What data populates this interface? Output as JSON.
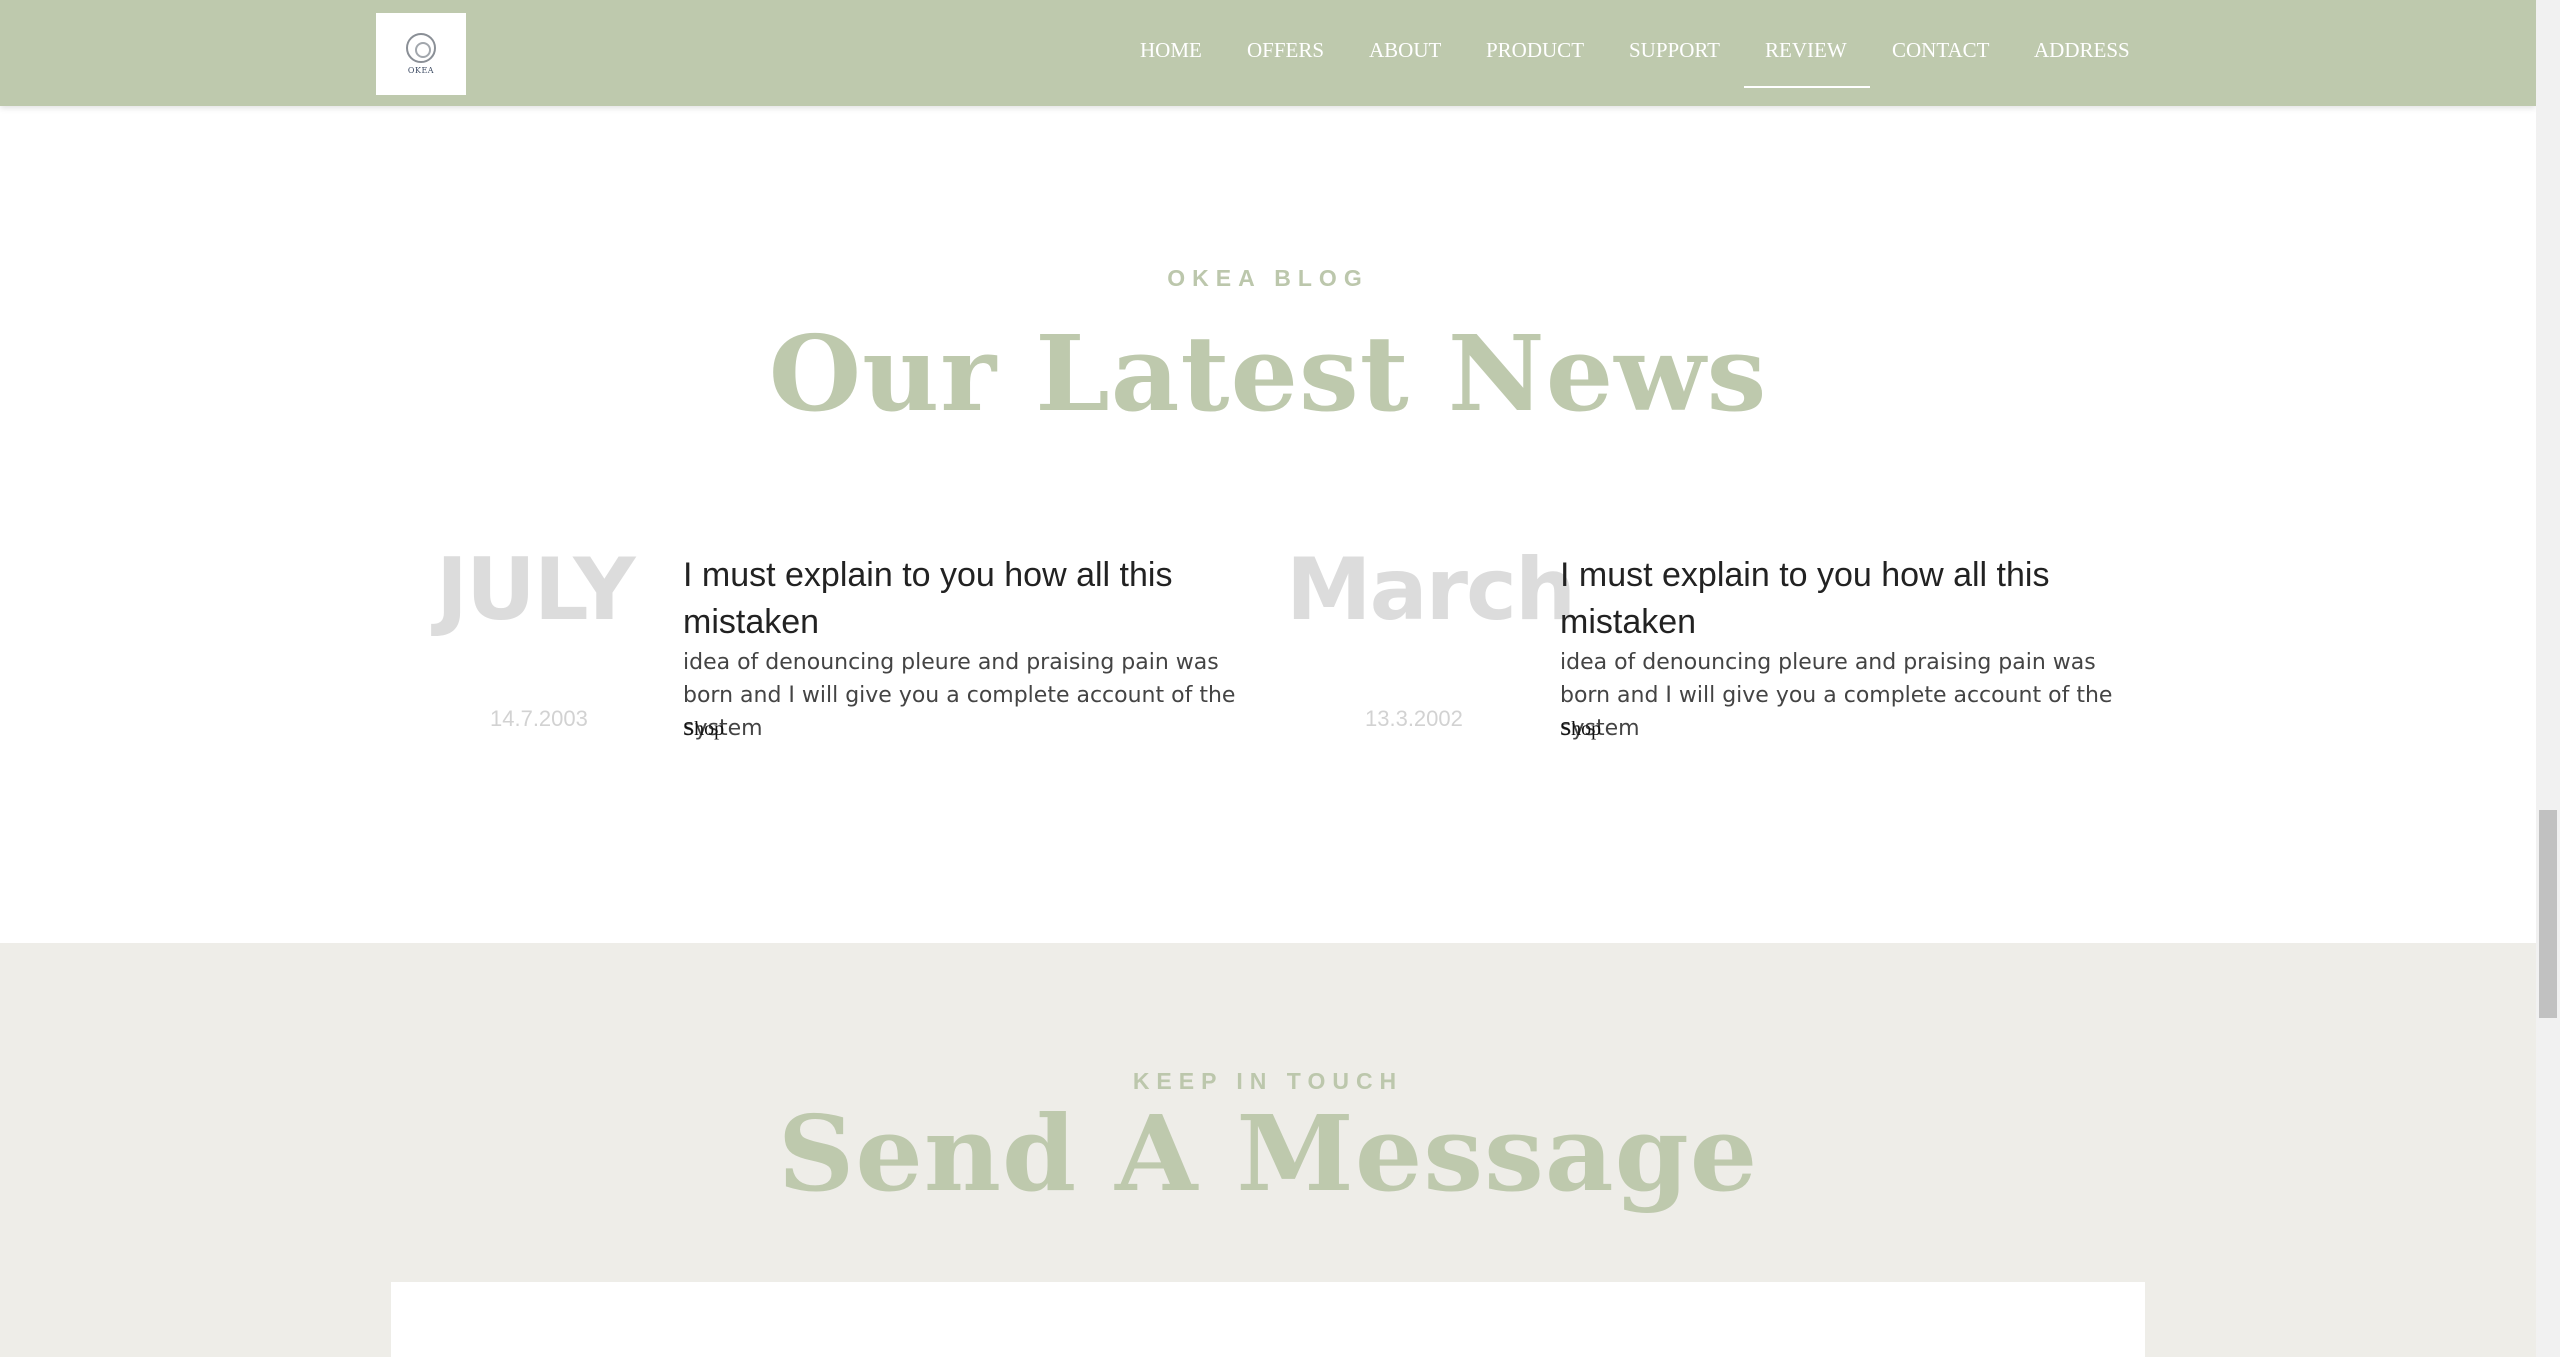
{
  "header": {
    "logo_text": "OKEA",
    "nav": [
      "HOME",
      "OFFERS",
      "ABOUT",
      "PRODUCT",
      "SUPPORT",
      "REVIEW",
      "CONTACT",
      "ADDRESS"
    ],
    "active": "REVIEW"
  },
  "blog": {
    "eyebrow": "OKEA BLOG",
    "title": "Our Latest News",
    "posts": [
      {
        "month": "JULY",
        "date": "14.7.2003",
        "title": "I must explain to you how all this mistaken",
        "excerpt": "idea of denouncing pleure and praising pain was born and I will give you a complete account of the system",
        "link": "Shop"
      },
      {
        "month": "March",
        "date": "13.3.2002",
        "title": "I must explain to you how all this mistaken",
        "excerpt": "idea of denouncing pleure and praising pain was born and I will give you a complete account of the system",
        "link": "Shop"
      }
    ]
  },
  "contact": {
    "eyebrow": "KEEP IN TOUCH",
    "title": "Send A Message"
  },
  "colors": {
    "header_bg": "#bec9ad",
    "accent": "#bcc7ac",
    "contact_bg": "#eeede8",
    "muted": "#dcdcdc"
  }
}
